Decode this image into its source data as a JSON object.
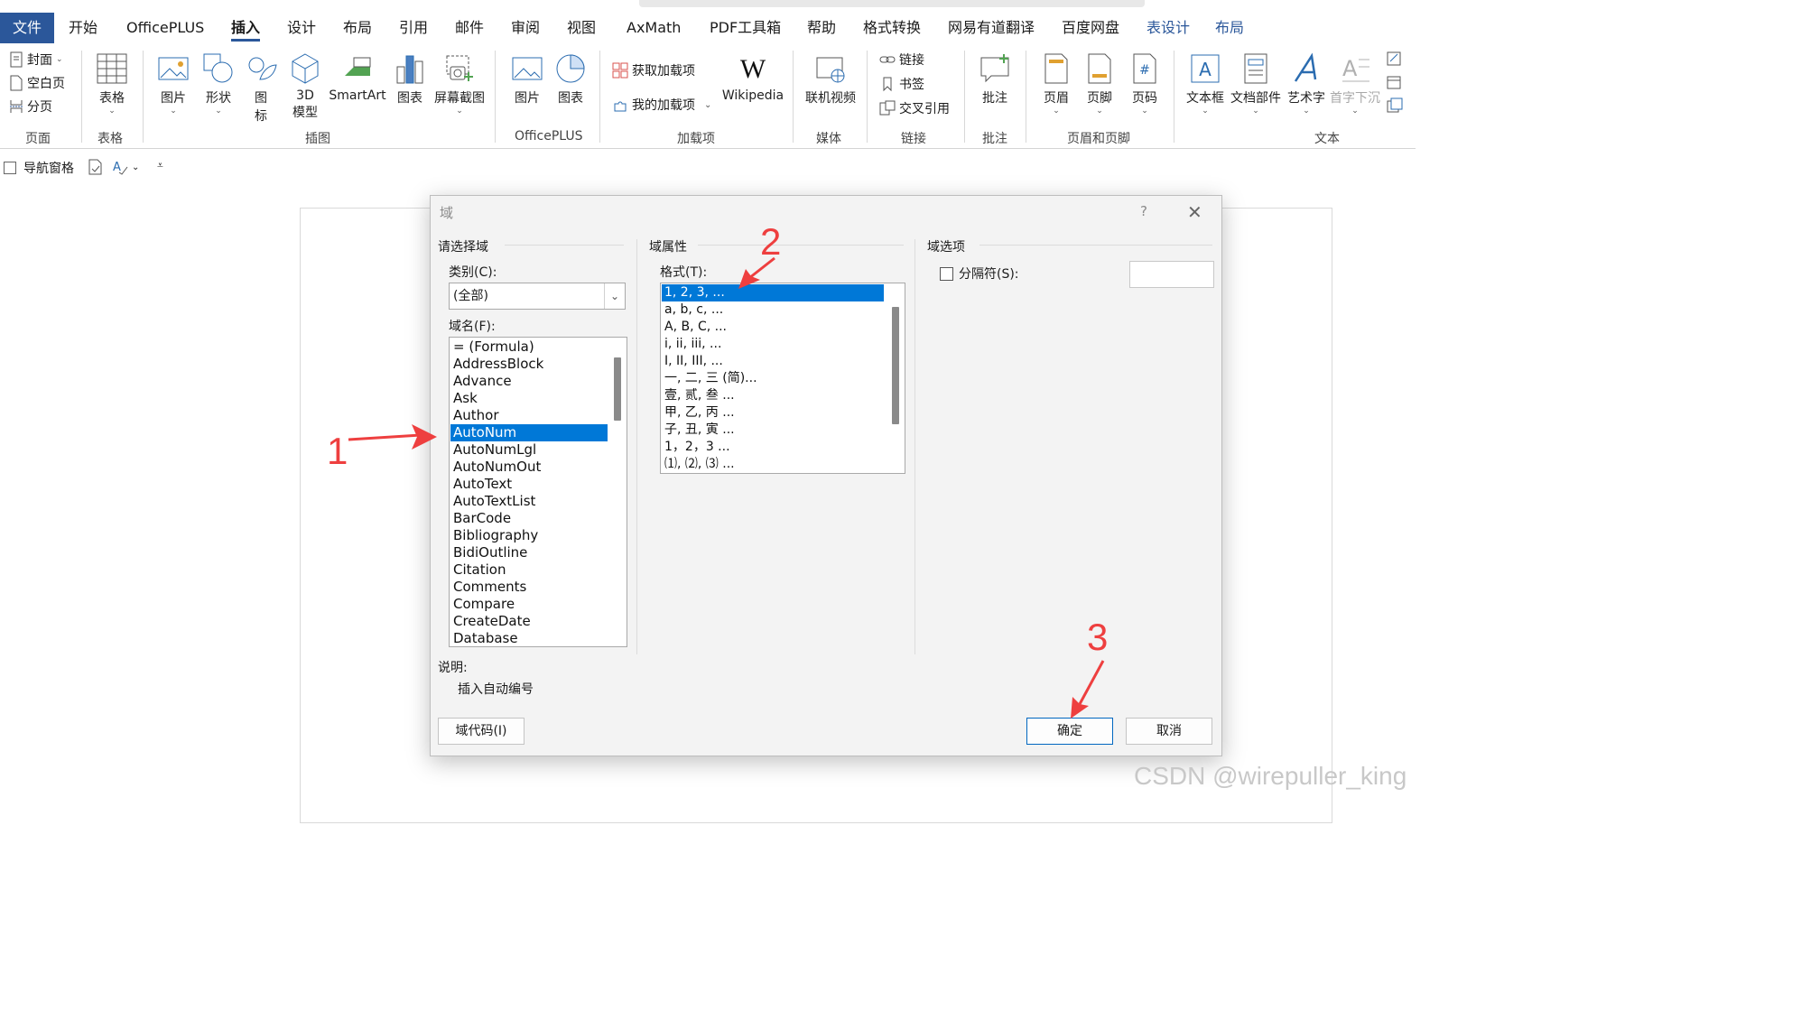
{
  "tabs": {
    "file": "文件",
    "home": "开始",
    "officeplus": "OfficePLUS",
    "insert": "插入",
    "design": "设计",
    "layout": "布局",
    "references": "引用",
    "mailings": "邮件",
    "review": "审阅",
    "view": "视图",
    "axmath": "AxMath",
    "pdf": "PDF工具箱",
    "help": "帮助",
    "format_convert": "格式转换",
    "youdao": "网易有道翻译",
    "baidu": "百度网盘",
    "table_design": "表设计",
    "table_layout": "布局"
  },
  "ribbon": {
    "pages": {
      "cover": "封面",
      "blank": "空白页",
      "break": "分页",
      "label": "页面"
    },
    "tables": {
      "table": "表格",
      "label": "表格"
    },
    "illustrations": {
      "picture": "图片",
      "shapes": "形状",
      "icons_1": "图",
      "icons_2": "标",
      "model_1": "3D",
      "model_2": "模型",
      "smartart": "SmartArt",
      "chart": "图表",
      "screenshot": "屏幕截图",
      "label": "插图"
    },
    "officeplus": {
      "picture": "图片",
      "chart": "图表",
      "label": "OfficePLUS"
    },
    "addins": {
      "get": "获取加载项",
      "mine": "我的加载项",
      "wikipedia": "Wikipedia",
      "label": "加载项"
    },
    "media": {
      "video": "联机视频",
      "label": "媒体"
    },
    "links": {
      "link": "链接",
      "bookmark": "书签",
      "crossref": "交叉引用",
      "label": "链接"
    },
    "comments": {
      "comment": "批注",
      "label": "批注"
    },
    "header_footer": {
      "header": "页眉",
      "footer": "页脚",
      "page_number": "页码",
      "label": "页眉和页脚"
    },
    "text": {
      "textbox": "文本框",
      "quickparts": "文档部件",
      "wordart": "艺术字",
      "dropcap": "首字下沉",
      "label": "文本"
    }
  },
  "qat": {
    "nav_pane": "导航窗格"
  },
  "dialog": {
    "title": "域",
    "help": "?",
    "left": {
      "section": "请选择域",
      "category_label": "类别(C):",
      "category_value": "(全部)",
      "fieldname_label": "域名(F):",
      "fields": [
        "= (Formula)",
        "AddressBlock",
        "Advance",
        "Ask",
        "Author",
        "AutoNum",
        "AutoNumLgl",
        "AutoNumOut",
        "AutoText",
        "AutoTextList",
        "BarCode",
        "Bibliography",
        "BidiOutline",
        "Citation",
        "Comments",
        "Compare",
        "CreateDate",
        "Database"
      ],
      "selected_field": "AutoNum"
    },
    "middle": {
      "section": "域属性",
      "format_label": "格式(T):",
      "formats": [
        "1, 2, 3, ...",
        "a, b, c, ...",
        "A, B, C, ...",
        "i, ii, iii, ...",
        "I, II, III, ...",
        "一, 二, 三 (简)...",
        "壹, 贰, 叁 ...",
        "甲, 乙, 丙 ...",
        "子, 丑, 寅 ...",
        "1，2，3 ...",
        "⑴, ⑵, ⑶ ..."
      ],
      "selected_format": "1, 2, 3, ..."
    },
    "right": {
      "section": "域选项",
      "separator_label": "分隔符(S):",
      "separator_checked": false,
      "separator_value": ""
    },
    "description_label": "说明:",
    "description": "插入自动编号",
    "field_codes_button": "域代码(I)",
    "ok_button": "确定",
    "cancel_button": "取消"
  },
  "annotations": {
    "step1": "1",
    "step2": "2",
    "step3": "3",
    "color": "#ee3f3f"
  },
  "watermark": "CSDN @wirepuller_king",
  "colors": {
    "accent": "#2b579a",
    "selection": "#0078d7"
  }
}
